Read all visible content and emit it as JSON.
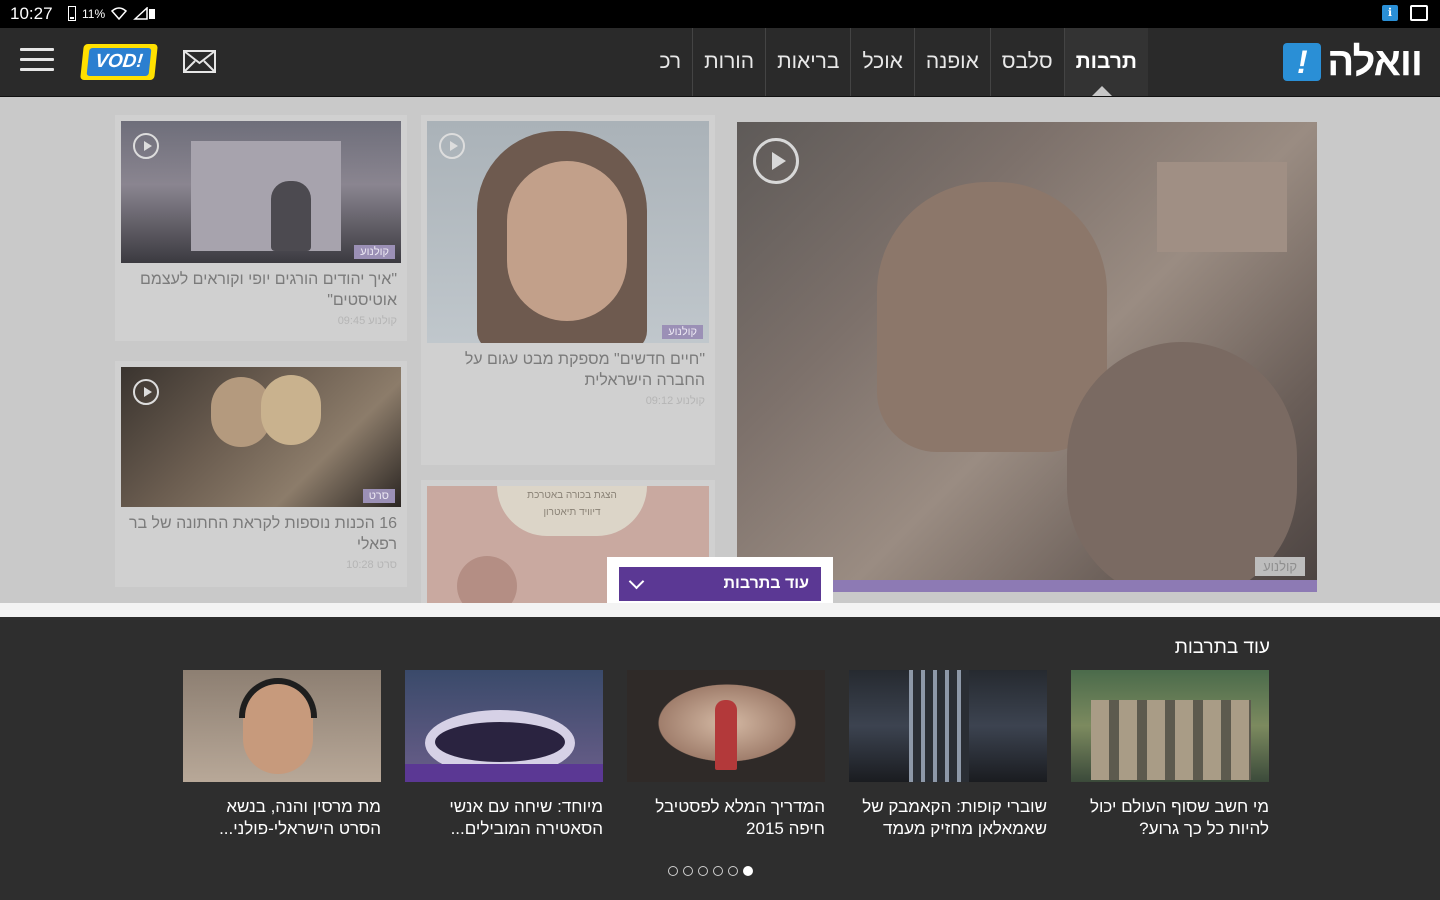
{
  "status_bar": {
    "time": "10:27",
    "battery_text": "11%"
  },
  "header": {
    "vod_logo": "VOD!",
    "walla_logo": "וואלה",
    "walla_bang": "!",
    "tabs": [
      {
        "label": "תרבות",
        "active": true
      },
      {
        "label": "סלבס"
      },
      {
        "label": "אופנה"
      },
      {
        "label": "אוכל"
      },
      {
        "label": "בריאות"
      },
      {
        "label": "הורות"
      },
      {
        "label": "רכ"
      }
    ]
  },
  "cards": [
    {
      "title": "\"איך יהודים הורגים יופי וקוראים לעצמם אוטיסטים\"",
      "tag": "קולנוע",
      "meta": "קולנוע  09:45"
    },
    {
      "title": "16 הכנות נוספות לקראת החתונה של בר רפאלי",
      "tag": "סרט",
      "meta": "סרט  10:28"
    },
    {
      "title": "\"חיים חדשים\" מספקת מבט עגום על החברה הישראלית",
      "tag": "קולנוע",
      "meta": "קולנוע  09:12"
    },
    {
      "title": "",
      "tag": "",
      "meta": ""
    }
  ],
  "poster_text": {
    "line1": "הצגת בכורה באטרכת",
    "line2": "דיוויד תיאטרון"
  },
  "big_tag": "קולנוע",
  "more_button": {
    "label": "עוד בתרבות"
  },
  "bottom": {
    "title": "עוד בתרבות",
    "items": [
      {
        "caption": "מי חשב שסוף העולם יכול להיות כל כך גרוע?"
      },
      {
        "caption": "שוברי קופות: הקאמבק של שאמאלאן מחזיק מעמד"
      },
      {
        "caption": "המדריך המלא לפסטיבל חיפה 2015"
      },
      {
        "caption": "מיוחד: שיחה עם אנשי הסאטירה המובילים..."
      },
      {
        "caption": "מת מרסין והנה, בנשא הסרט הישראלי-פולני..."
      }
    ]
  },
  "pagination": {
    "count": 6,
    "active_index": 5
  },
  "colors": {
    "accent_purple": "#5b3894",
    "walla_blue": "#2a8fd6",
    "vod_yellow": "#ffe000"
  }
}
